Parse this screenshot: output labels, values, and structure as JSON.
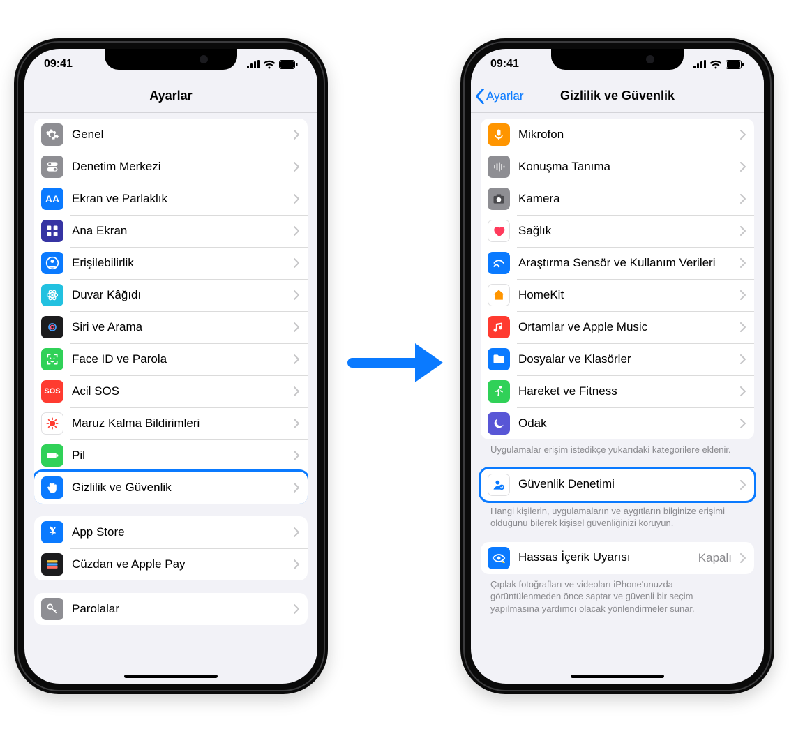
{
  "status": {
    "time": "09:41"
  },
  "left": {
    "title": "Ayarlar",
    "groups": [
      {
        "rows": [
          {
            "id": "general",
            "label": "Genel",
            "icon": "gear",
            "bg": "#8e8e93"
          },
          {
            "id": "control-center",
            "label": "Denetim Merkezi",
            "icon": "toggles",
            "bg": "#8e8e93"
          },
          {
            "id": "display",
            "label": "Ekran ve Parlaklık",
            "icon": "aa",
            "bg": "#0a7aff"
          },
          {
            "id": "home-screen",
            "label": "Ana Ekran",
            "icon": "grid",
            "bg": "#3634a3"
          },
          {
            "id": "accessibility",
            "label": "Erişilebilirlik",
            "icon": "person-circle",
            "bg": "#0a7aff"
          },
          {
            "id": "wallpaper",
            "label": "Duvar Kâğıdı",
            "icon": "atom",
            "bg": "#22c1e0"
          },
          {
            "id": "siri",
            "label": "Siri ve Arama",
            "icon": "siri",
            "bg": "#1c1c1e"
          },
          {
            "id": "faceid",
            "label": "Face ID ve Parola",
            "icon": "faceid",
            "bg": "#30d158"
          },
          {
            "id": "sos",
            "label": "Acil SOS",
            "icon": "sos",
            "bg": "#ff3b30"
          },
          {
            "id": "exposure",
            "label": "Maruz Kalma Bildirimleri",
            "icon": "virus",
            "bg": "#ffffff"
          },
          {
            "id": "battery",
            "label": "Pil",
            "icon": "battery",
            "bg": "#30d158"
          },
          {
            "id": "privacy",
            "label": "Gizlilik ve Güvenlik",
            "icon": "hand",
            "bg": "#0a7aff",
            "highlight": true
          }
        ]
      },
      {
        "rows": [
          {
            "id": "appstore",
            "label": "App Store",
            "icon": "appstore",
            "bg": "#0a7aff"
          },
          {
            "id": "wallet",
            "label": "Cüzdan ve Apple Pay",
            "icon": "wallet",
            "bg": "#1c1c1e"
          }
        ]
      },
      {
        "rows": [
          {
            "id": "passwords",
            "label": "Parolalar",
            "icon": "key",
            "bg": "#8e8e93"
          }
        ]
      }
    ]
  },
  "right": {
    "back": "Ayarlar",
    "title": "Gizlilik ve Güvenlik",
    "groups": [
      {
        "rows": [
          {
            "id": "microphone",
            "label": "Mikrofon",
            "icon": "mic",
            "bg": "#ff9500"
          },
          {
            "id": "speech",
            "label": "Konuşma Tanıma",
            "icon": "wave",
            "bg": "#8e8e93"
          },
          {
            "id": "camera",
            "label": "Kamera",
            "icon": "camera",
            "bg": "#8e8e93"
          },
          {
            "id": "health",
            "label": "Sağlık",
            "icon": "heart",
            "bg": "#ffffff"
          },
          {
            "id": "research",
            "label": "Araştırma Sensör ve Kullanım Verileri",
            "icon": "sensor",
            "bg": "#0a7aff"
          },
          {
            "id": "homekit",
            "label": "HomeKit",
            "icon": "home",
            "bg": "#ffffff"
          },
          {
            "id": "media",
            "label": "Ortamlar ve Apple Music",
            "icon": "music",
            "bg": "#ff3b30"
          },
          {
            "id": "files",
            "label": "Dosyalar ve Klasörler",
            "icon": "folder",
            "bg": "#0a7aff"
          },
          {
            "id": "fitness",
            "label": "Hareket ve Fitness",
            "icon": "runner",
            "bg": "#30d158"
          },
          {
            "id": "focus",
            "label": "Odak",
            "icon": "moon",
            "bg": "#5856d6"
          }
        ],
        "footer": "Uygulamalar erişim istedikçe yukarıdaki kategorilere eklenir."
      },
      {
        "rows": [
          {
            "id": "safety-check",
            "label": "Güvenlik Denetimi",
            "icon": "person-check",
            "bg": "#ffffff",
            "blueicon": true,
            "highlight": true
          }
        ],
        "footer": "Hangi kişilerin, uygulamaların ve aygıtların bilginize erişimi olduğunu bilerek kişisel güvenliğinizi koruyun."
      },
      {
        "rows": [
          {
            "id": "sensitive",
            "label": "Hassas İçerik Uyarısı",
            "icon": "eye-warn",
            "bg": "#0a7aff",
            "value": "Kapalı"
          }
        ],
        "footer": "Çıplak fotoğrafları ve videoları iPhone'unuzda görüntülenmeden önce saptar ve güvenli bir seçim yapılmasına yardımcı olacak yönlendirmeler sunar."
      }
    ]
  }
}
